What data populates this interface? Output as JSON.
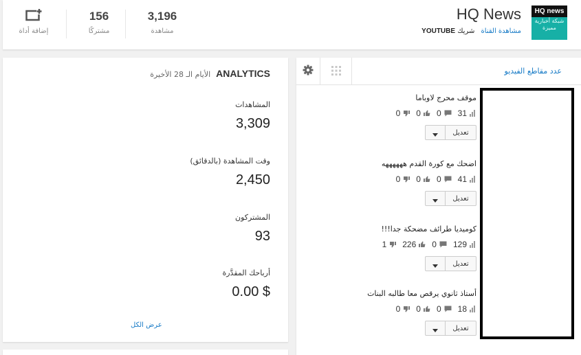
{
  "header": {
    "channel_name": "HQ News",
    "logo_text_top": "HQ news",
    "logo_text_bottom": "شبكة أخبارية مميزة",
    "view_channel": "مشاهدة القناة",
    "partner_label": "شريك",
    "partner_name": "YOUTUBE",
    "views_count": "3,196",
    "views_label": "مشاهدة",
    "subs_count": "156",
    "subs_label": "مشتركًا",
    "add_label": "إضافة أداة",
    "add_icon": "add-widget-icon"
  },
  "analytics": {
    "title": "ANALYTICS",
    "period": "الأيام الـ 28 الأخيرة",
    "metrics": [
      {
        "label": "المشاهدات",
        "value": "3,309"
      },
      {
        "label": "وقت المشاهدة (بالدقائق)",
        "value": "2,450"
      },
      {
        "label": "المشتركون",
        "value": "93"
      },
      {
        "label": "أرباحك المقدَّرة",
        "value": "0.00 $"
      }
    ],
    "see_all": "عرض الكل"
  },
  "videos": {
    "title": "عدد مقاطع الفيديو",
    "edit_label": "تعديل",
    "items": [
      {
        "title": "موقف محرج لاوباما",
        "views": "31",
        "comments": "0",
        "likes": "0",
        "dislikes": "0"
      },
      {
        "title": "اضحك مع كورة القدم ههههههه",
        "views": "41",
        "comments": "0",
        "likes": "0",
        "dislikes": "0"
      },
      {
        "title": "كوميديا طرائف مضحكة جدا!!!",
        "views": "129",
        "comments": "0",
        "likes": "226",
        "dislikes": "1"
      },
      {
        "title": "أستاذ ثانوي يرقص معا طالبه البنات",
        "views": "18",
        "comments": "0",
        "likes": "0",
        "dislikes": "0"
      }
    ]
  },
  "colors": {
    "link": "#167ac6",
    "logo_bg": "#17b0a6"
  }
}
